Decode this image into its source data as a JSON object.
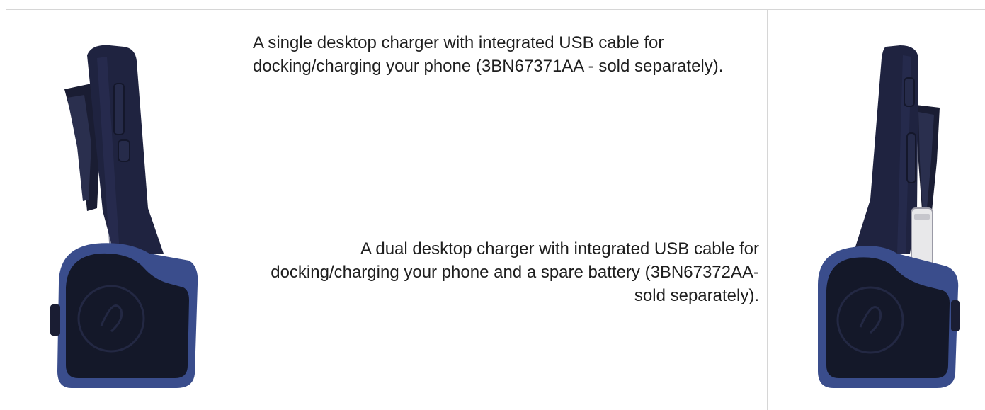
{
  "rows": {
    "single": {
      "description": "A single desktop charger with integrated USB cable for docking/charging your phone (3BN67371AA - sold separately)."
    },
    "dual": {
      "description": "A dual desktop charger with integrated USB cable for docking/charging your phone and a spare battery (3BN67372AA- sold separately)."
    }
  },
  "colors": {
    "border": "#d6d6d6",
    "text": "#1e1e1e",
    "phone_body": "#1f2340",
    "charger_body": "#3a4d8c",
    "charger_face": "#141829"
  },
  "images": {
    "left": "single-charger-photo",
    "right": "dual-charger-photo"
  }
}
